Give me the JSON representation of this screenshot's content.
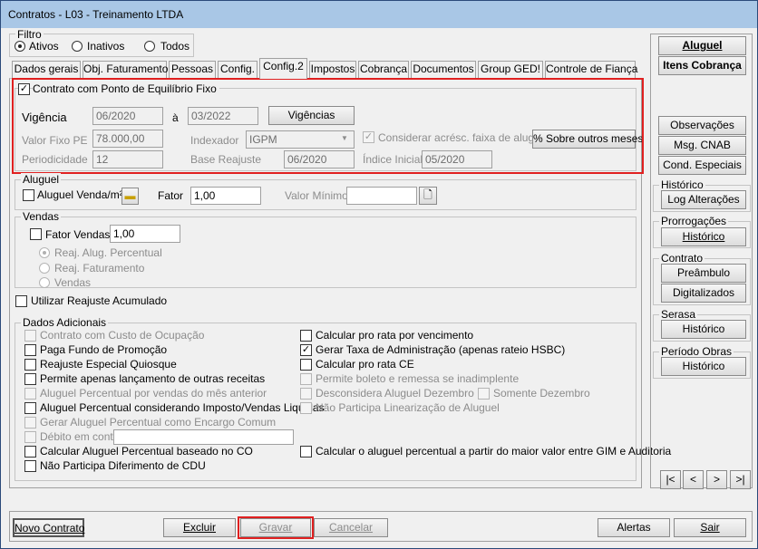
{
  "window": {
    "title": "Contratos - L03 - Treinamento LTDA"
  },
  "filtro": {
    "label": "Filtro",
    "options": [
      "Ativos",
      "Inativos",
      "Todos"
    ]
  },
  "tabs": [
    "Dados gerais",
    "Obj. Faturamento",
    "Pessoas",
    "Config.",
    "Config.2",
    "Impostos",
    "Cobrança",
    "Documentos",
    "Group GED!",
    "Controle de Fiança"
  ],
  "equilibrio": {
    "checkbox_label": "Contrato com Ponto de Equilíbrio Fixo",
    "vigencia_label": "Vigência",
    "vigencia_from": "06/2020",
    "a_label": "à",
    "vigencia_to": "03/2022",
    "vigencias_button": "Vigências",
    "valor_fixo_label": "Valor Fixo PE",
    "valor_fixo": "78.000,00",
    "indexador_label": "Indexador",
    "indexador": "IGPM",
    "considerar_label": "Considerar acrésc. faixa de aluguel",
    "sobre_button": "% Sobre outros meses",
    "periodicidade_label": "Periodicidade",
    "periodicidade": "12",
    "base_reajuste_label": "Base Reajuste",
    "base_reajuste": "06/2020",
    "indice_inicial_label": "Índice Inicial",
    "indice_inicial": "05/2020"
  },
  "aluguel": {
    "label": "Aluguel",
    "venda_label": "Aluguel Venda/m²",
    "fator_label": "Fator",
    "fator": "1,00",
    "valor_minimo_label": "Valor Mínimo",
    "valor_minimo": ""
  },
  "vendas": {
    "label": "Vendas",
    "fator_label": "Fator Vendas",
    "fator": "1,00",
    "options": [
      "Reaj. Alug. Percentual",
      "Reaj. Faturamento",
      "Vendas"
    ]
  },
  "reajuste_acumulado": "Utilizar Reajuste Acumulado",
  "dados": {
    "label": "Dados Adicionais",
    "left": [
      "Contrato com Custo de Ocupação",
      "Paga Fundo de Promoção",
      "Reajuste Especial Quiosque",
      "Permite apenas lançamento de outras receitas",
      "Aluguel Percentual por vendas do mês anterior",
      "Aluguel Percentual considerando Imposto/Vendas Liquidas",
      "Gerar Aluguel Percentual como Encargo Comum",
      "Débito em conta",
      "Calcular Aluguel Percentual baseado no CO",
      "Não Participa Diferimento de CDU"
    ],
    "right": [
      "Calcular pro rata por vencimento",
      "Gerar Taxa de Administração (apenas rateio HSBC)",
      "Calcular pro rata CE",
      "Permite boleto e remessa se inadimplente",
      "Desconsidera Aluguel Dezembro",
      "Não Participa Linearização de Aluguel",
      "Calcular o aluguel percentual a partir do maior valor entre GIM e Auditoria"
    ],
    "somente_dezembro": "Somente Dezembro"
  },
  "side": {
    "aluguel": "Aluguel",
    "itens": "Itens Cobrança",
    "observacoes": "Observações",
    "msg": "Msg. CNAB",
    "cond": "Cond. Especiais",
    "historico_label": "Histórico",
    "log": "Log Alterações",
    "prorrogacoes_label": "Prorrogações",
    "historico_btn": "Histórico",
    "contrato_label": "Contrato",
    "preambulo": "Preâmbulo",
    "digitalizados": "Digitalizados",
    "serasa_label": "Serasa",
    "periodo_label": "Período Obras",
    "nav": [
      "|<",
      "<",
      ">",
      ">|"
    ]
  },
  "bottom": {
    "novo": "Novo Contrato",
    "excluir": "Excluir",
    "gravar": "Gravar",
    "cancelar": "Cancelar",
    "alertas": "Alertas",
    "sair": "Sair"
  }
}
